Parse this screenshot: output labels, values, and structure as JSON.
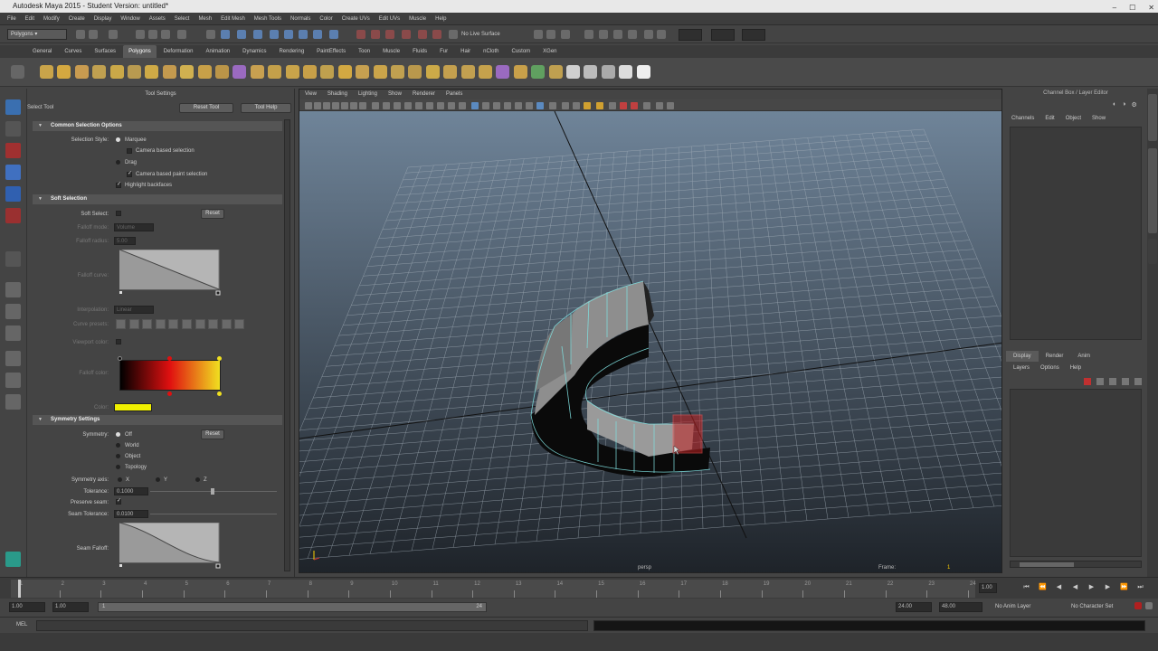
{
  "app": {
    "title": "Autodesk Maya 2015 - Student Version: untitled*",
    "window_buttons": [
      "–",
      "☐",
      "✕"
    ]
  },
  "menubar": [
    "File",
    "Edit",
    "Modify",
    "Create",
    "Display",
    "Window",
    "Assets",
    "Select",
    "Mesh",
    "Edit Mesh",
    "Mesh Tools",
    "Normals",
    "Color",
    "Create UVs",
    "Edit UVs",
    "Muscle",
    "Help"
  ],
  "statusline": {
    "mode": "Polygons",
    "no_live_surface": "No Live Surface"
  },
  "shelf_tabs": [
    {
      "label": "General",
      "active": false
    },
    {
      "label": "Curves",
      "active": false
    },
    {
      "label": "Surfaces",
      "active": false
    },
    {
      "label": "Polygons",
      "active": true
    },
    {
      "label": "Deformation",
      "active": false
    },
    {
      "label": "Animation",
      "active": false
    },
    {
      "label": "Dynamics",
      "active": false
    },
    {
      "label": "Rendering",
      "active": false
    },
    {
      "label": "PaintEffects",
      "active": false
    },
    {
      "label": "Toon",
      "active": false
    },
    {
      "label": "Muscle",
      "active": false
    },
    {
      "label": "Fluids",
      "active": false
    },
    {
      "label": "Fur",
      "active": false
    },
    {
      "label": "Hair",
      "active": false
    },
    {
      "label": "nCloth",
      "active": false
    },
    {
      "label": "Custom",
      "active": false
    },
    {
      "label": "XGen",
      "active": false
    }
  ],
  "tool_settings": {
    "header": "Tool Settings",
    "tool_name": "Select Tool",
    "reset_tool": "Reset Tool",
    "tool_help": "Tool Help",
    "sections": {
      "common": "Common Selection Options",
      "soft": "Soft Selection",
      "symmetry": "Symmetry Settings"
    },
    "selection_style_label": "Selection Style:",
    "marquee": "Marquee",
    "camera_based_selection": "Camera based selection",
    "drag": "Drag",
    "camera_based_paint_selection": "Camera based paint selection",
    "highlight_backfaces": "Highlight backfaces",
    "soft_select_label": "Soft Select:",
    "reset": "Reset",
    "falloff_mode_label": "Falloff mode:",
    "falloff_mode_value": "Volume",
    "falloff_radius_label": "Falloff radius:",
    "falloff_radius_value": "5.00",
    "falloff_curve_label": "Falloff curve:",
    "interpolation_label": "Interpolation:",
    "interpolation_value": "Linear",
    "curve_presets_label": "Curve presets:",
    "viewport_color_label": "Viewport color:",
    "falloff_color_label": "Falloff color:",
    "color_label": "Color:",
    "symmetry_label": "Symmetry:",
    "symmetry_off": "Off",
    "symmetry_world": "World",
    "symmetry_object": "Object",
    "symmetry_topology": "Topology",
    "symmetry_axis_label": "Symmetry axis:",
    "axis_x": "X",
    "axis_y": "Y",
    "axis_z": "Z",
    "tolerance_label": "Tolerance:",
    "tolerance_value": "0.1000",
    "preserve_seam_label": "Preserve seam:",
    "seam_tolerance_label": "Seam Tolerance:",
    "seam_tolerance_value": "0.0100",
    "seam_falloff_label": "Seam Falloff:"
  },
  "viewport": {
    "menu": [
      "View",
      "Shading",
      "Lighting",
      "Show",
      "Renderer",
      "Panels"
    ],
    "camera_label": "persp",
    "frame_label": "Frame:",
    "frame_value": "1"
  },
  "channel_box": {
    "title": "Channel Box / Layer Editor",
    "menu": [
      "Channels",
      "Edit",
      "Object",
      "Show"
    ],
    "layer_tabs": [
      "Display",
      "Render",
      "Anim"
    ],
    "layer_menu": [
      "Layers",
      "Options",
      "Help"
    ]
  },
  "timeline": {
    "ticks": [
      "1",
      "2",
      "3",
      "4",
      "5",
      "6",
      "7",
      "8",
      "9",
      "10",
      "11",
      "12",
      "13",
      "14",
      "15",
      "16",
      "17",
      "18",
      "19",
      "20",
      "21",
      "22",
      "23",
      "24"
    ],
    "current_frame": "1.00",
    "range_start": "1.00",
    "range_inner_start": "1.00",
    "range_end_marker": "24",
    "range_inner_end": "24.00",
    "range_end": "48.00",
    "anim_layer": "No Anim Layer",
    "character_set": "No Character Set"
  },
  "cmdline": {
    "label": "MEL"
  },
  "colors": {
    "falloff_gradient": [
      "#000000",
      "#e01010",
      "#f0e020"
    ],
    "soft_color": "#f0f000",
    "selected_face": "#c02020",
    "wire": "#7fe0e0"
  }
}
